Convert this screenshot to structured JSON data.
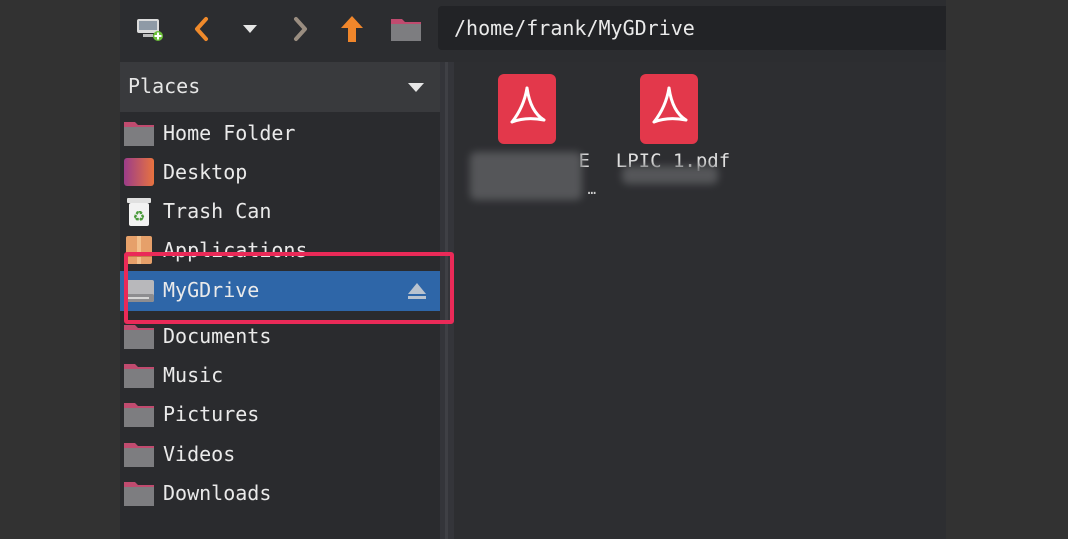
{
  "toolbar": {
    "buttons": [
      {
        "name": "computer-icon"
      },
      {
        "name": "back-icon"
      },
      {
        "name": "history-dropdown-icon"
      },
      {
        "name": "forward-icon"
      },
      {
        "name": "up-icon"
      },
      {
        "name": "folder-icon"
      }
    ],
    "path": "/home/frank/MyGDrive"
  },
  "sidebar": {
    "header": "Places",
    "items": [
      {
        "label": "Home Folder",
        "icon": "folder-home-icon"
      },
      {
        "label": "Desktop",
        "icon": "desktop-icon"
      },
      {
        "label": "Trash Can",
        "icon": "trash-icon"
      },
      {
        "label": "Applications",
        "icon": "applications-icon"
      },
      {
        "label": "MyGDrive",
        "icon": "drive-icon",
        "selected": true
      },
      {
        "label": "Documents",
        "icon": "folder-icon"
      },
      {
        "label": "Music",
        "icon": "folder-icon"
      },
      {
        "label": "Pictures",
        "icon": "folder-icon"
      },
      {
        "label": "Videos",
        "icon": "folder-icon"
      },
      {
        "label": "Downloads",
        "icon": "folder-icon"
      }
    ]
  },
  "files": [
    {
      "name": "E",
      "icon": "pdf-icon",
      "line2": "…"
    },
    {
      "name": "LPIC 1.pdf",
      "icon": "pdf-icon"
    }
  ],
  "colors": {
    "selection": "#2e66a8",
    "highlight": "#ea2a58",
    "pdf": "#e3384b",
    "folder": "#c04b6f"
  }
}
